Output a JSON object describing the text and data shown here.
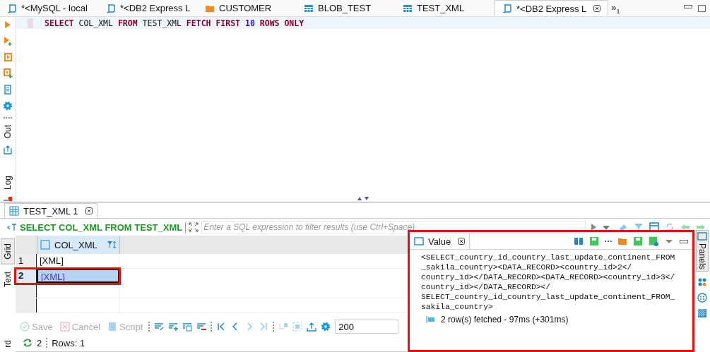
{
  "editor_tabs": [
    {
      "label": "*<MySQL - local",
      "kind": "script",
      "selected": false
    },
    {
      "label": "*<DB2 Express L",
      "kind": "script",
      "selected": false
    },
    {
      "label": "CUSTOMER",
      "kind": "folder",
      "selected": false
    },
    {
      "label": "BLOB_TEST",
      "kind": "table",
      "selected": false
    },
    {
      "label": "TEST_XML",
      "kind": "table",
      "selected": false
    },
    {
      "label": "*<DB2 Express L",
      "kind": "script",
      "selected": true
    }
  ],
  "overflow_tabs": {
    "label": "»",
    "count": "1"
  },
  "query": [
    {
      "text": "SELECT",
      "kind": "keyword"
    },
    {
      "text": "COL_XML",
      "kind": "name"
    },
    {
      "text": "FROM",
      "kind": "keyword"
    },
    {
      "text": "TEST_XML",
      "kind": "name"
    },
    {
      "text": "FETCH",
      "kind": "keyword"
    },
    {
      "text": "FIRST",
      "kind": "keyword"
    },
    {
      "text": "10",
      "kind": "number"
    },
    {
      "text": "ROWS",
      "kind": "keyword"
    },
    {
      "text": "ONLY",
      "kind": "keyword"
    }
  ],
  "side_panels": [
    "Out",
    "Log"
  ],
  "results_tab": {
    "label": "TEST_XML 1"
  },
  "filter": {
    "query": "SELECT COL_XML FROM TEST_XML",
    "placeholder": "Enter a SQL expression to filter results (use Ctrl+Space)"
  },
  "view_tabs": [
    {
      "label": "Grid",
      "selected": true
    },
    {
      "label": "Text",
      "selected": false
    },
    {
      "label": "rd",
      "selected": false
    }
  ],
  "grid": {
    "column": "COL_XML",
    "rows": [
      {
        "number": "1",
        "value": "[XML]",
        "selected": false
      },
      {
        "number": "2",
        "value": "[XML]",
        "selected": true
      }
    ]
  },
  "actions": [
    {
      "label": "Save",
      "kind": "save"
    },
    {
      "label": "Cancel",
      "kind": "cancel"
    },
    {
      "label": "Script",
      "kind": "script"
    }
  ],
  "fetch_size": "200",
  "status": {
    "refresh_count": "2",
    "rows": "Rows: 1"
  },
  "value_panel": {
    "title": "Value",
    "highlighted": true,
    "lines": [
      "<SELECT_country_id_country_last_update_continent_FROM",
      "_sakila_country><DATA_RECORD><country_id>2</",
      "country_id></DATA_RECORD><DATA_RECORD><country_id>3</",
      "country_id></DATA_RECORD></",
      "SELECT_country_id_country_last_update_continent_FROM_",
      "sakila_country>"
    ],
    "fetched": "2 row(s) fetched - 97ms (+301ms)"
  },
  "panels_tab": "Panels"
}
